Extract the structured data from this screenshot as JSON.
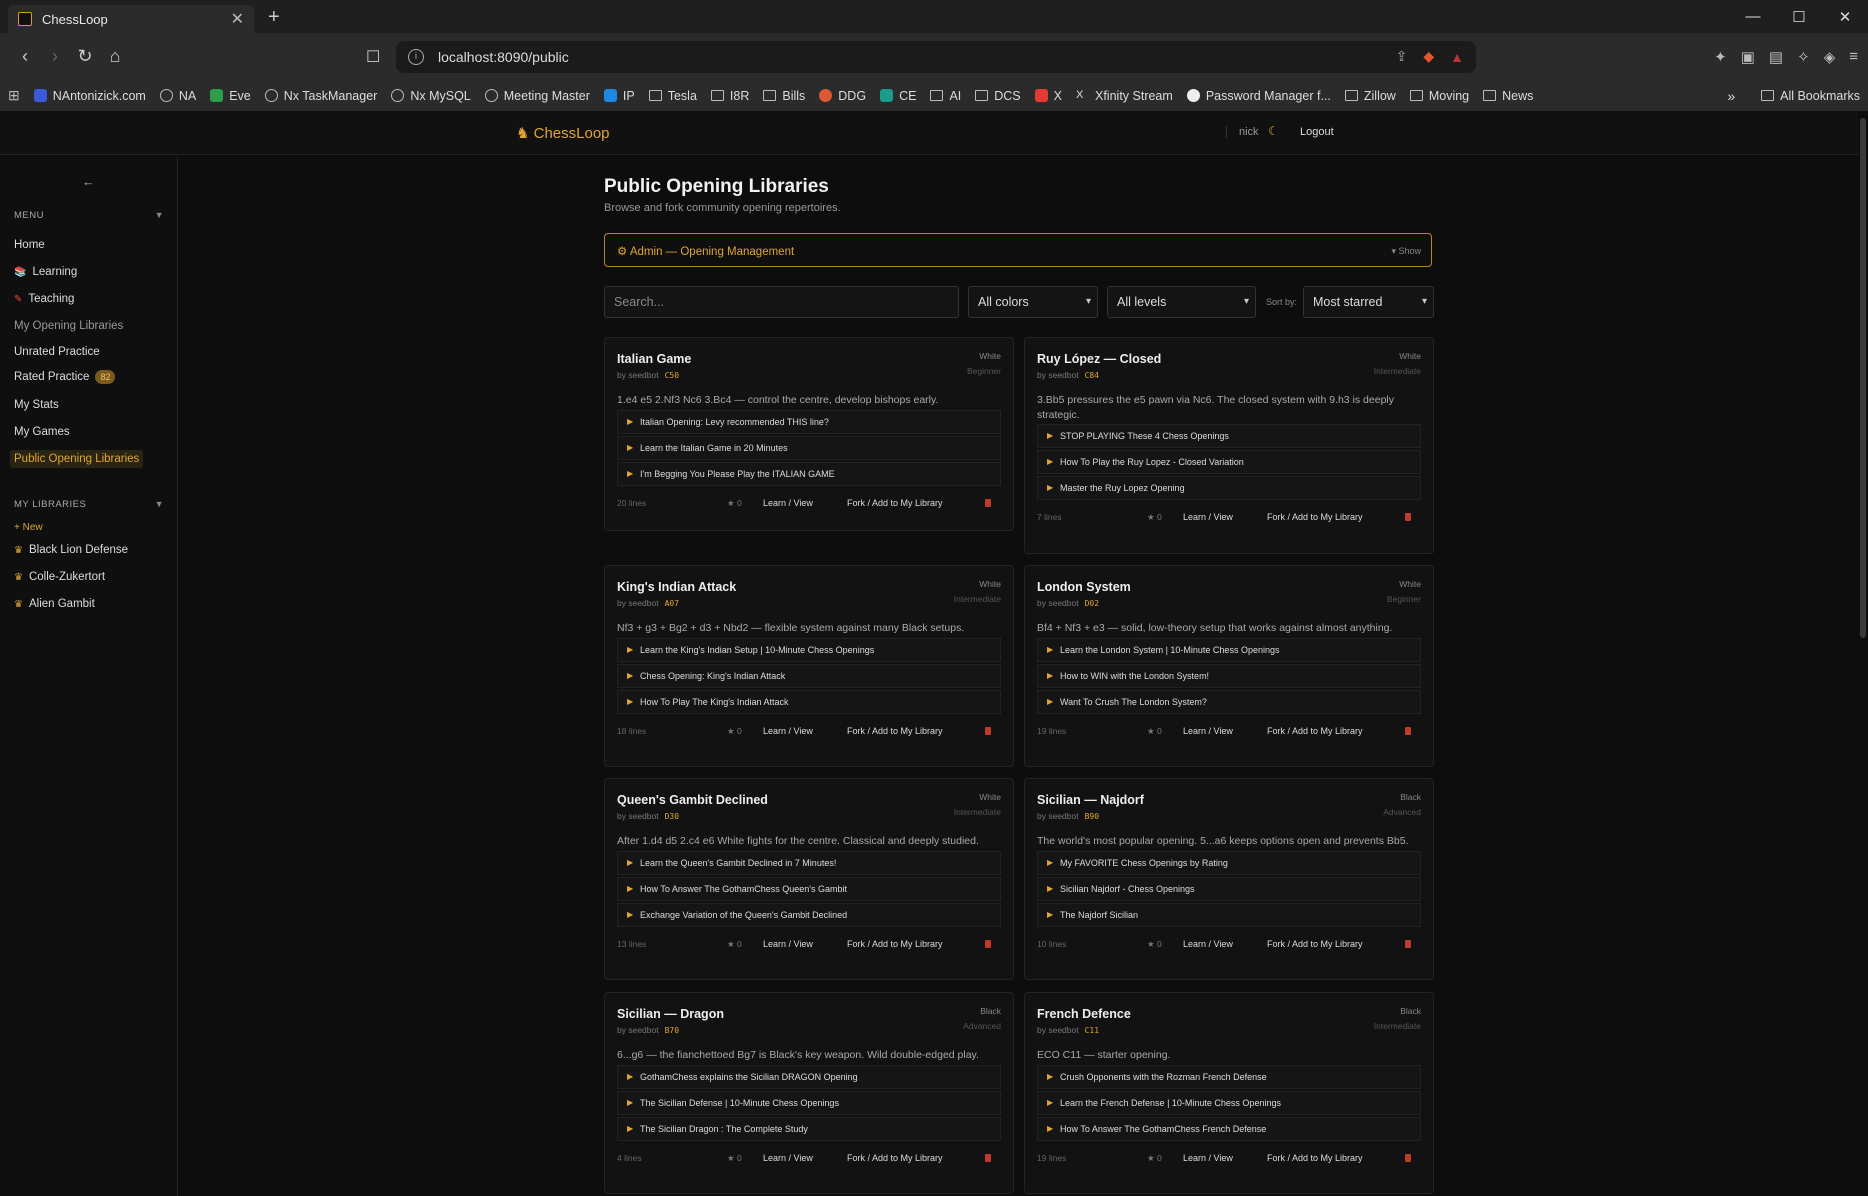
{
  "browser": {
    "tab_title": "ChessLoop",
    "url": "localhost:8090/public",
    "bookmarks": [
      "NAntonizick.com",
      "NA",
      "Eve",
      "Nx TaskManager",
      "Nx MySQL",
      "Meeting Master",
      "IP",
      "Tesla",
      "I8R",
      "Bills",
      "DDG",
      "CE",
      "AI",
      "DCS",
      "X",
      "Xfinity Stream",
      "Password Manager f...",
      "Zillow",
      "Moving",
      "News"
    ],
    "all_bookmarks": "All Bookmarks"
  },
  "app": {
    "brand": "ChessLoop",
    "user": "nick",
    "logout": "Logout"
  },
  "sidebar": {
    "collapse": "←",
    "menu_header": "MENU",
    "menu": [
      "Home",
      "Learning",
      "Teaching",
      "My Opening Libraries",
      "Unrated Practice",
      "Rated Practice",
      "My Stats",
      "My Games",
      "Public Opening Libraries"
    ],
    "rated_badge": "82",
    "libraries_header": "MY LIBRARIES",
    "new_link": "+ New",
    "libraries": [
      "Black Lion Defense",
      "Colle-Zukertort",
      "Alien Gambit"
    ]
  },
  "page": {
    "title": "Public Opening Libraries",
    "subtitle": "Browse and fork community opening repertoires.",
    "admin_label": "Admin — Opening Management",
    "admin_show": "▾ Show",
    "search_placeholder": "Search...",
    "color_filter": "All colors",
    "level_filter": "All levels",
    "sort_label": "Sort by:",
    "sort_value": "Most starred"
  },
  "cards": [
    {
      "name": "Italian Game",
      "author": "by seedbot",
      "eco": "C50",
      "color": "White",
      "level": "Beginner",
      "desc": "1.e4 e5 2.Nf3 Nc6 3.Bc4 — control the centre, develop bishops early.",
      "videos": [
        "Italian Opening: Levy recommended THIS line?",
        "Learn the Italian Game in 20 Minutes",
        "I'm Begging You Please Play the ITALIAN GAME"
      ],
      "lines": "20 lines",
      "stars": "★ 0",
      "learn": "Learn / View",
      "fork": "Fork / Add to My Library"
    },
    {
      "name": "Ruy López — Closed",
      "author": "by seedbot",
      "eco": "C84",
      "color": "White",
      "level": "Intermediate",
      "desc": "3.Bb5 pressures the e5 pawn via Nc6. The closed system with 9.h3 is deeply strategic.",
      "videos": [
        "STOP PLAYING These 4 Chess Openings",
        "How To Play the Ruy Lopez - Closed Variation",
        "Master the Ruy Lopez Opening"
      ],
      "lines": "7 lines",
      "stars": "★ 0",
      "learn": "Learn / View",
      "fork": "Fork / Add to My Library"
    },
    {
      "name": "King's Indian Attack",
      "author": "by seedbot",
      "eco": "A07",
      "color": "White",
      "level": "Intermediate",
      "desc": "Nf3 + g3 + Bg2 + d3 + Nbd2 — flexible system against many Black setups.",
      "videos": [
        "Learn the King's Indian Setup | 10-Minute Chess Openings",
        "Chess Opening: King's Indian Attack",
        "How To Play The King's Indian Attack"
      ],
      "lines": "18 lines",
      "stars": "★ 0",
      "learn": "Learn / View",
      "fork": "Fork / Add to My Library"
    },
    {
      "name": "London System",
      "author": "by seedbot",
      "eco": "D02",
      "color": "White",
      "level": "Beginner",
      "desc": "Bf4 + Nf3 + e3 — solid, low-theory setup that works against almost anything.",
      "videos": [
        "Learn the London System | 10-Minute Chess Openings",
        "How to WIN with the London System!",
        "Want To Crush The London System?"
      ],
      "lines": "19 lines",
      "stars": "★ 0",
      "learn": "Learn / View",
      "fork": "Fork / Add to My Library"
    },
    {
      "name": "Queen's Gambit Declined",
      "author": "by seedbot",
      "eco": "D30",
      "color": "White",
      "level": "Intermediate",
      "desc": "After 1.d4 d5 2.c4 e6 White fights for the centre. Classical and deeply studied.",
      "videos": [
        "Learn the Queen's Gambit Declined in 7 Minutes!",
        "How To Answer The GothamChess Queen's Gambit",
        "Exchange Variation of the Queen's Gambit Declined"
      ],
      "lines": "13 lines",
      "stars": "★ 0",
      "learn": "Learn / View",
      "fork": "Fork / Add to My Library"
    },
    {
      "name": "Sicilian — Najdorf",
      "author": "by seedbot",
      "eco": "B90",
      "color": "Black",
      "level": "Advanced",
      "desc": "The world's most popular opening. 5...a6 keeps options open and prevents Bb5.",
      "videos": [
        "My FAVORITE Chess Openings by Rating",
        "Sicilian Najdorf - Chess Openings",
        "The Najdorf Sicilian"
      ],
      "lines": "10 lines",
      "stars": "★ 0",
      "learn": "Learn / View",
      "fork": "Fork / Add to My Library"
    },
    {
      "name": "Sicilian — Dragon",
      "author": "by seedbot",
      "eco": "B70",
      "color": "Black",
      "level": "Advanced",
      "desc": "6...g6 — the fianchettoed Bg7 is Black's key weapon. Wild double-edged play.",
      "videos": [
        "GothamChess explains the Sicilian DRAGON Opening",
        "The Sicilian Defense | 10-Minute Chess Openings",
        "The Sicilian Dragon : The Complete Study"
      ],
      "lines": "4 lines",
      "stars": "★ 0",
      "learn": "Learn / View",
      "fork": "Fork / Add to My Library"
    },
    {
      "name": "French Defence",
      "author": "by seedbot",
      "eco": "C11",
      "color": "Black",
      "level": "Intermediate",
      "desc": "ECO C11 — starter opening.",
      "videos": [
        "Crush Opponents with the Rozman French Defense",
        "Learn the French Defense | 10-Minute Chess Openings",
        "How To Answer The GothamChess French Defense"
      ],
      "lines": "19 lines",
      "stars": "★ 0",
      "learn": "Learn / View",
      "fork": "Fork / Add to My Library"
    }
  ]
}
